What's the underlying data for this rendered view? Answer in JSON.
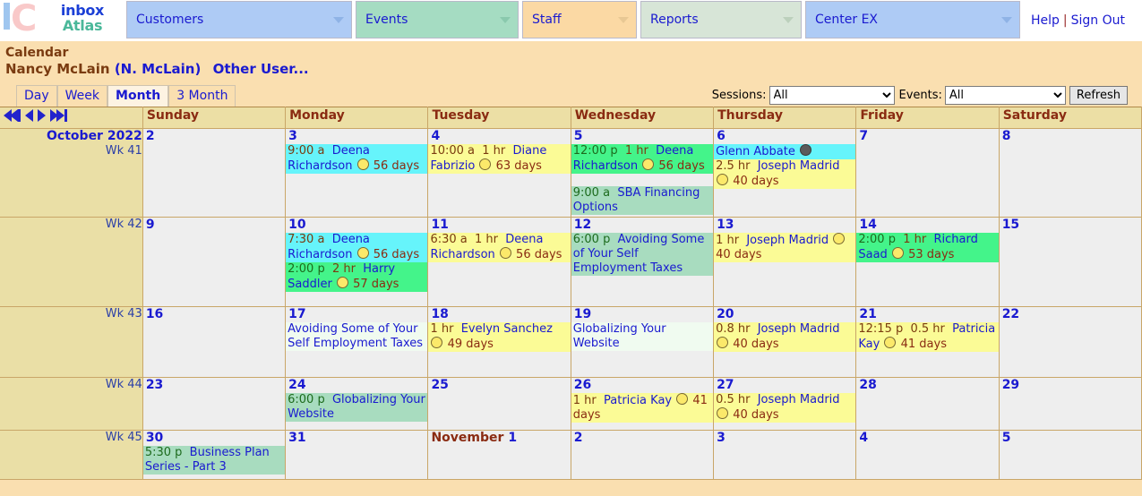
{
  "brand": {
    "logo_text_line1": "inbox",
    "logo_text_line2": "Atlas",
    "logo_letter_i": "i",
    "logo_letter_c": "C"
  },
  "topnav": {
    "items": [
      {
        "label": "Customers",
        "color": "#aecbf5"
      },
      {
        "label": "Events",
        "color": "#a5dcc2"
      },
      {
        "label": "Staff",
        "color": "#fbd9a4"
      },
      {
        "label": "Reports",
        "color": "#d7e5d7"
      },
      {
        "label": "Center EX",
        "color": "#aecbf5"
      }
    ],
    "help": "Help",
    "separator": "|",
    "sign_out": "Sign Out"
  },
  "page": {
    "title": "Calendar",
    "user_name": "Nancy McLain",
    "user_login": "(N. McLain)",
    "other_user": "Other User..."
  },
  "view_tabs": [
    {
      "label": "Day",
      "active": false
    },
    {
      "label": "Week",
      "active": false
    },
    {
      "label": "Month",
      "active": true
    },
    {
      "label": "3 Month",
      "active": false
    }
  ],
  "filters": {
    "sessions_label": "Sessions:",
    "sessions_value": "All",
    "sessions_options": [
      "All"
    ],
    "events_label": "Events:",
    "events_value": "All",
    "events_options": [
      "All"
    ],
    "refresh_label": "Refresh"
  },
  "nav_buttons": [
    {
      "name": "first",
      "glyph": "first"
    },
    {
      "name": "prev",
      "glyph": "prev"
    },
    {
      "name": "next",
      "glyph": "next"
    },
    {
      "name": "last",
      "glyph": "last"
    }
  ],
  "calendar": {
    "day_headers": [
      "Sunday",
      "Monday",
      "Tuesday",
      "Wednesday",
      "Thursday",
      "Friday",
      "Saturday"
    ],
    "month_label": "October 2022",
    "weeks": [
      {
        "week_label": "Wk 41",
        "days": [
          {
            "num": "2",
            "events": []
          },
          {
            "num": "3",
            "events": [
              {
                "bg": "cyan",
                "time": "9:00 a",
                "dur": "",
                "name": "Deena Richardson",
                "dot": "open",
                "days": "56 days"
              }
            ]
          },
          {
            "num": "4",
            "events": [
              {
                "bg": "yellow",
                "time": "10:00 a",
                "dur": "1 hr",
                "name": "Diane Fabrizio",
                "dot": "open",
                "days": "63 days"
              }
            ]
          },
          {
            "num": "5",
            "events": [
              {
                "bg": "green",
                "time": "12:00 p",
                "dur": "1 hr",
                "name": "Deena Richardson",
                "dot": "open",
                "days": "56 days"
              },
              {
                "bg": "mint",
                "time": "9:00 a",
                "dur": "",
                "name": "SBA Financing Options",
                "dot": "",
                "days": "",
                "spacer": true
              }
            ]
          },
          {
            "num": "6",
            "events": [
              {
                "bg": "cyan",
                "time": "",
                "dur": "",
                "name": "Glenn Abbate",
                "dot": "done",
                "days": ""
              },
              {
                "bg": "yellow",
                "time": "",
                "dur": "2.5 hr",
                "name": "Joseph Madrid",
                "dot": "open",
                "days": "40 days"
              }
            ]
          },
          {
            "num": "7",
            "events": []
          },
          {
            "num": "8",
            "events": []
          }
        ]
      },
      {
        "week_label": "Wk 42",
        "days": [
          {
            "num": "9",
            "events": []
          },
          {
            "num": "10",
            "events": [
              {
                "bg": "cyan",
                "time": "7:30 a",
                "dur": "",
                "name": "Deena Richardson",
                "dot": "open",
                "days": "56 days"
              },
              {
                "bg": "green",
                "time": "2:00 p",
                "dur": "2 hr",
                "name": "Harry Saddler",
                "dot": "open",
                "days": "57 days"
              }
            ]
          },
          {
            "num": "11",
            "events": [
              {
                "bg": "yellow",
                "time": "6:30 a",
                "dur": "1 hr",
                "name": "Deena Richardson",
                "dot": "open",
                "days": "56 days"
              }
            ]
          },
          {
            "num": "12",
            "events": [
              {
                "bg": "mint",
                "time": "6:00 p",
                "dur": "",
                "name": "Avoiding Some of Your Self Employment Taxes",
                "dot": "",
                "days": ""
              }
            ]
          },
          {
            "num": "13",
            "events": [
              {
                "bg": "yellow",
                "time": "",
                "dur": "1 hr",
                "name": "Joseph Madrid",
                "dot": "open",
                "days": "40 days"
              }
            ]
          },
          {
            "num": "14",
            "events": [
              {
                "bg": "green",
                "time": "2:00 p",
                "dur": "1 hr",
                "name": "Richard Saad",
                "dot": "open",
                "days": "53 days"
              }
            ]
          },
          {
            "num": "15",
            "events": []
          }
        ]
      },
      {
        "week_label": "Wk 43",
        "days": [
          {
            "num": "16",
            "events": []
          },
          {
            "num": "17",
            "events": [
              {
                "bg": "palemint",
                "time": "",
                "dur": "",
                "name": "Avoiding Some of Your Self Employment Taxes",
                "dot": "",
                "days": ""
              }
            ]
          },
          {
            "num": "18",
            "events": [
              {
                "bg": "yellow",
                "time": "",
                "dur": "1 hr",
                "name": "Evelyn Sanchez",
                "dot": "open",
                "days": "49 days"
              }
            ]
          },
          {
            "num": "19",
            "events": [
              {
                "bg": "palemint",
                "time": "",
                "dur": "",
                "name": "Globalizing Your Website",
                "dot": "",
                "days": ""
              }
            ]
          },
          {
            "num": "20",
            "events": [
              {
                "bg": "yellow",
                "time": "",
                "dur": "0.8 hr",
                "name": "Joseph Madrid",
                "dot": "open",
                "days": "40 days"
              }
            ]
          },
          {
            "num": "21",
            "events": [
              {
                "bg": "yellow",
                "time": "12:15 p",
                "dur": "0.5 hr",
                "name": "Patricia Kay",
                "dot": "open",
                "days": "41 days"
              }
            ]
          },
          {
            "num": "22",
            "events": []
          }
        ]
      },
      {
        "week_label": "Wk 44",
        "days": [
          {
            "num": "23",
            "events": []
          },
          {
            "num": "24",
            "events": [
              {
                "bg": "mint",
                "time": "6:00 p",
                "dur": "",
                "name": "Globalizing Your Website",
                "dot": "",
                "days": ""
              }
            ]
          },
          {
            "num": "25",
            "events": []
          },
          {
            "num": "26",
            "events": [
              {
                "bg": "yellow",
                "time": "",
                "dur": "1 hr",
                "name": "Patricia Kay",
                "dot": "open",
                "days": "41 days"
              }
            ]
          },
          {
            "num": "27",
            "events": [
              {
                "bg": "yellow",
                "time": "",
                "dur": "0.5 hr",
                "name": "Joseph Madrid",
                "dot": "open",
                "days": "40 days"
              }
            ]
          },
          {
            "num": "28",
            "events": []
          },
          {
            "num": "29",
            "events": []
          }
        ]
      },
      {
        "week_label": "Wk 45",
        "days": [
          {
            "num": "30",
            "events": [
              {
                "bg": "mint",
                "time": "5:30 p",
                "dur": "",
                "name": "Business Plan Series - Part 3",
                "dot": "",
                "days": ""
              }
            ]
          },
          {
            "num": "31",
            "events": []
          },
          {
            "num": "1",
            "month_name": "November",
            "events": []
          },
          {
            "num": "2",
            "events": []
          },
          {
            "num": "3",
            "events": []
          },
          {
            "num": "4",
            "events": []
          },
          {
            "num": "5",
            "events": []
          }
        ]
      }
    ]
  }
}
